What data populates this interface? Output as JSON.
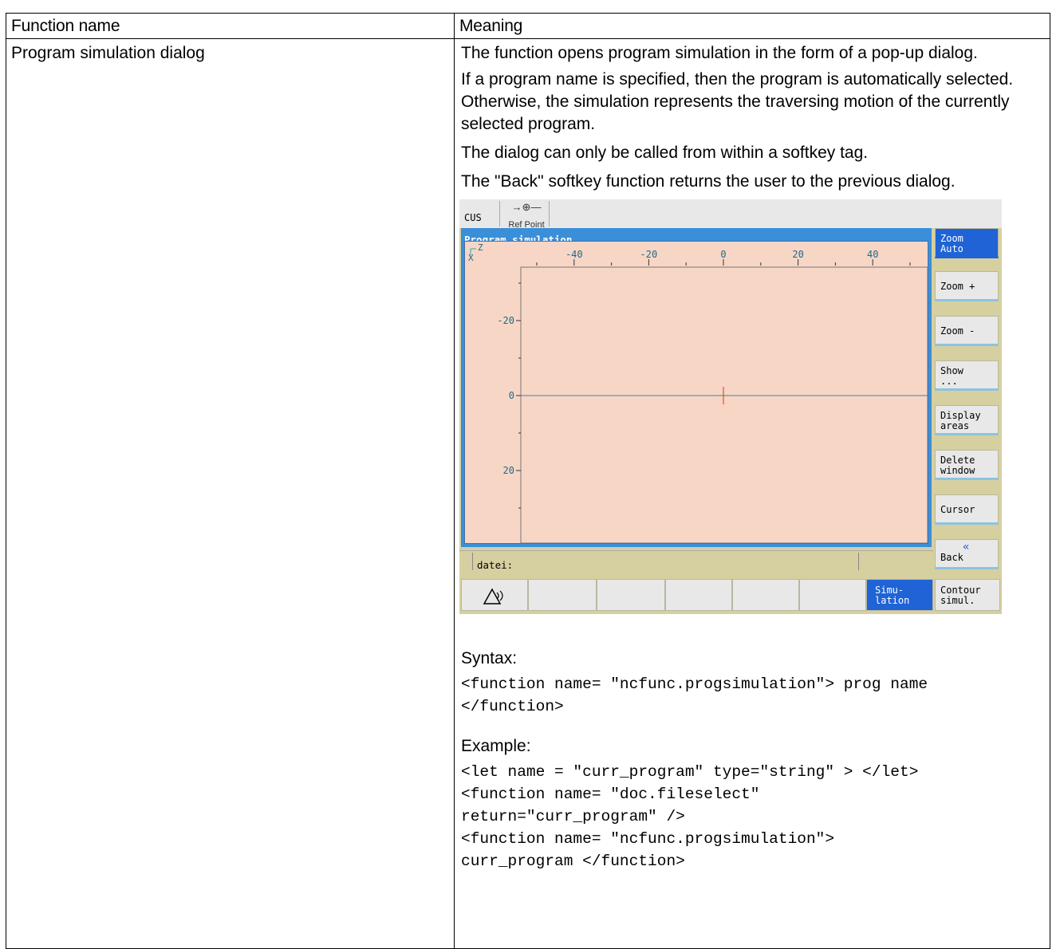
{
  "table": {
    "headers": [
      "Function name",
      "Meaning"
    ],
    "function_name": "Program simulation dialog",
    "paragraphs": [
      "The function opens program simulation in the form of a pop-up dialog.",
      "If a program name is specified, then the program is automatically selected. Otherwise, the simulation represents the traversing motion of the currently selected program.",
      "The dialog can only be called from within a softkey tag.",
      "The \"Back\" softkey function returns the user to the previous dialog."
    ],
    "syntax_heading": "Syntax:",
    "syntax_code": "<function name= \"ncfunc.progsimulation\"> prog name\n</function>",
    "example_heading": "Example:",
    "example_code": "<let name = \"curr_program\" type=\"string\" > </let>\n<function name= \"doc.fileselect\"\nreturn=\"curr_program\" />\n<function name= \"ncfunc.progsimulation\">\ncurr_program </function>"
  },
  "hmi": {
    "mode": "CUS",
    "ref_point": "Ref Point",
    "window_title": "Program simulation",
    "axis_z": "Z",
    "axis_x": "X",
    "top_ticks": [
      "-40",
      "-20",
      "0",
      "20",
      "40"
    ],
    "left_ticks": [
      "-20",
      "0",
      "20"
    ],
    "status_label": "datei:",
    "vertical_softkeys": [
      {
        "line1": "Zoom",
        "line2": "Auto",
        "active": true
      },
      {
        "line1": "Zoom +",
        "line2": ""
      },
      {
        "line1": "Zoom -",
        "line2": ""
      },
      {
        "line1": "Show",
        "line2": "..."
      },
      {
        "line1": "Display",
        "line2": "areas"
      },
      {
        "line1": "Delete",
        "line2": "window"
      },
      {
        "line1": "Cursor",
        "line2": ""
      },
      {
        "line1": "Back",
        "line2": "«"
      }
    ],
    "bottom_softkeys": {
      "simulation_line1": "Simu-",
      "simulation_line2": "lation",
      "contour_line1": "Contour",
      "contour_line2": "simul."
    },
    "colors": {
      "window_blue": "#3a8fd8",
      "canvas": "#f7d6c6",
      "panel": "#d6d0a0",
      "active_key": "#1f63d6"
    }
  }
}
